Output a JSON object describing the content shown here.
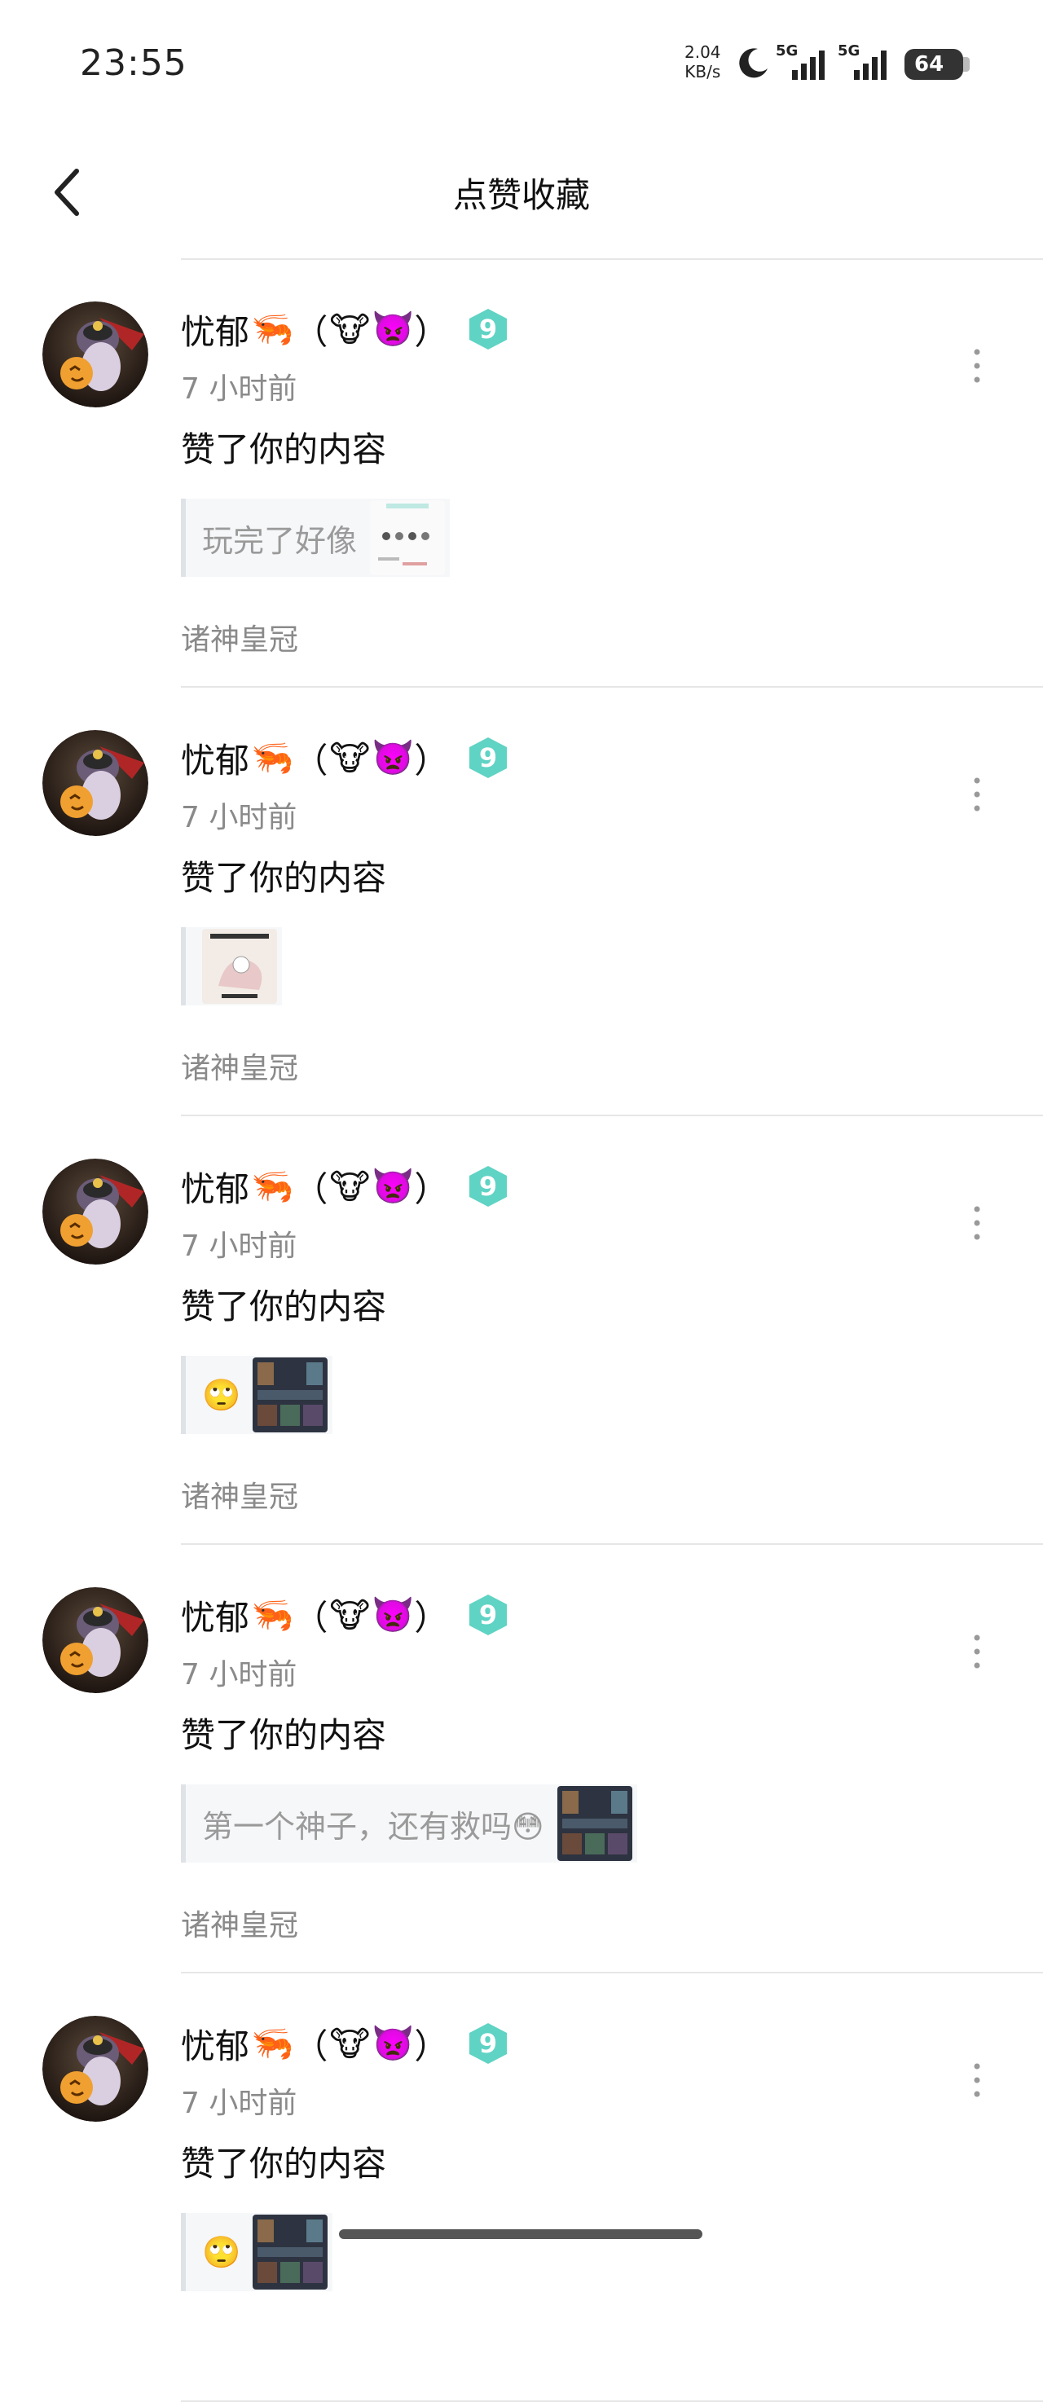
{
  "status_bar": {
    "time": "23:55",
    "net_speed_value": "2.04",
    "net_speed_unit": "KB/s",
    "network_1": "5G",
    "network_2": "5G",
    "battery": "64",
    "icons": [
      "moon-icon",
      "signal-icon",
      "signal-icon",
      "battery-icon"
    ]
  },
  "header": {
    "title": "点赞收藏",
    "back_icon": "chevron-left-icon"
  },
  "notifications": [
    {
      "username": "忧郁",
      "name_emoji_1": "🦐",
      "name_paren_open": "（",
      "name_emoji_2": "🐮",
      "name_emoji_3": "👿",
      "name_paren_close": "）",
      "time": "7 小时前",
      "action": "赞了你的内容",
      "quote_text": "玩完了好像",
      "quote_emoji": "",
      "thumbs": [
        "screenshot-thumb"
      ],
      "source": "诸神皇冠"
    },
    {
      "username": "忧郁",
      "name_emoji_1": "🦐",
      "name_paren_open": "（",
      "name_emoji_2": "🐮",
      "name_emoji_3": "👿",
      "name_paren_close": "）",
      "time": "7 小时前",
      "action": "赞了你的内容",
      "quote_text": "",
      "quote_emoji": "",
      "thumbs": [
        "meme-thumb"
      ],
      "source": "诸神皇冠"
    },
    {
      "username": "忧郁",
      "name_emoji_1": "🦐",
      "name_paren_open": "（",
      "name_emoji_2": "🐮",
      "name_emoji_3": "👿",
      "name_paren_close": "）",
      "time": "7 小时前",
      "action": "赞了你的内容",
      "quote_text": "",
      "quote_emoji": "🙄",
      "thumbs": [
        "game-thumb"
      ],
      "source": "诸神皇冠"
    },
    {
      "username": "忧郁",
      "name_emoji_1": "🦐",
      "name_paren_open": "（",
      "name_emoji_2": "🐮",
      "name_emoji_3": "👿",
      "name_paren_close": "）",
      "time": "7 小时前",
      "action": "赞了你的内容",
      "quote_text": "第一个神子，还有救吗😳",
      "quote_emoji": "",
      "thumbs": [
        "game-thumb"
      ],
      "source": "诸神皇冠"
    },
    {
      "username": "忧郁",
      "name_emoji_1": "🦐",
      "name_paren_open": "（",
      "name_emoji_2": "🐮",
      "name_emoji_3": "👿",
      "name_paren_close": "）",
      "time": "7 小时前",
      "action": "赞了你的内容",
      "quote_text": "",
      "quote_emoji": "🙄",
      "thumbs": [
        "game-thumb"
      ],
      "source": ""
    }
  ],
  "level_badge": "9",
  "colors": {
    "accent_badge": "#5fd3c4",
    "secondary_text": "#8a8a8a",
    "quote_bg": "#f6f7f9"
  }
}
